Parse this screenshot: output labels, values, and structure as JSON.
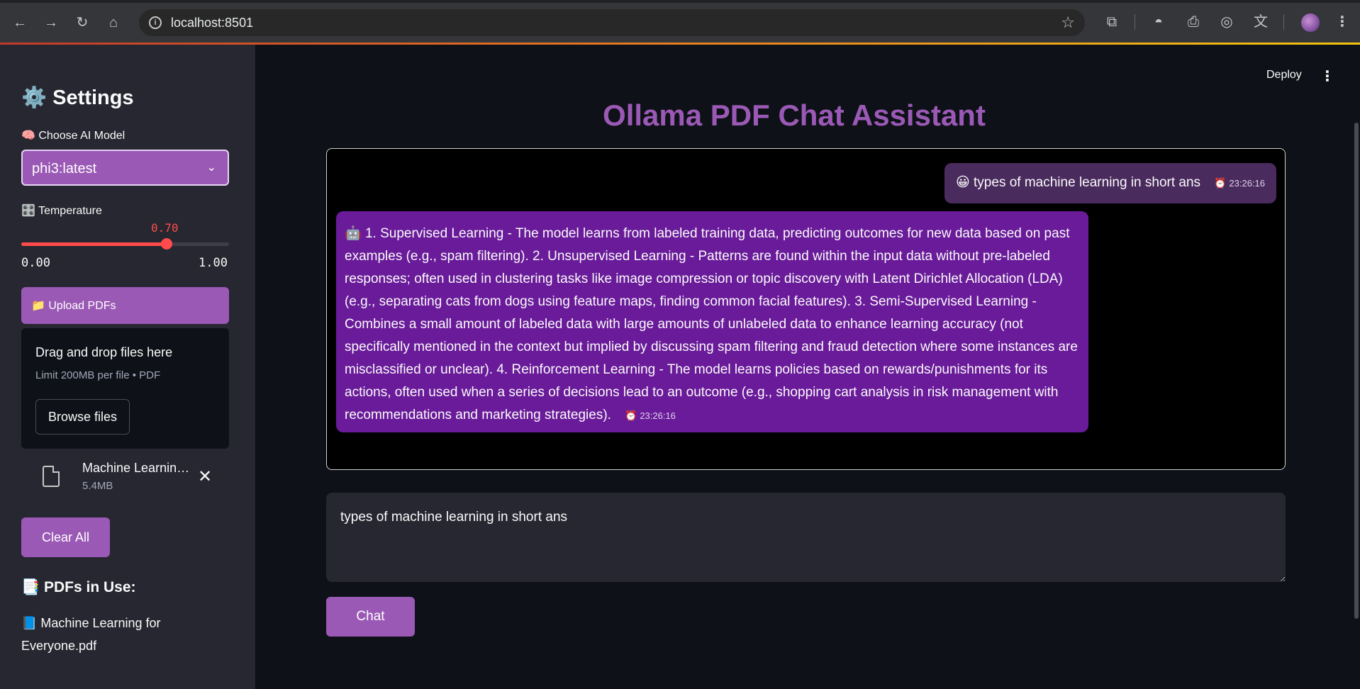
{
  "browser": {
    "url": "localhost:8501"
  },
  "sidebar": {
    "title": "⚙️ Settings",
    "model_label": "🧠 Choose AI Model",
    "model_value": "phi3:latest",
    "temperature_label": "🎛️ Temperature",
    "temperature_value": "0.70",
    "temperature_fraction": 0.7,
    "temperature_min": "0.00",
    "temperature_max": "1.00",
    "upload_label": "📁 Upload PDFs",
    "dropzone_title": "Drag and drop files here",
    "dropzone_limit": "Limit 200MB per file • PDF",
    "browse_label": "Browse files",
    "file_name": "Machine Learning for Everyone.pdf",
    "file_size": "5.4MB",
    "clear_label": "Clear All",
    "pdfs_title": "📑 PDFs in Use:",
    "pdf_items": [
      "📘 Machine Learning for Everyone.pdf"
    ]
  },
  "main": {
    "deploy_label": "Deploy",
    "title": "Ollama PDF Chat Assistant",
    "user_message": {
      "emoji": "😀",
      "text": "types of machine learning in short ans",
      "time": "23:26:16"
    },
    "bot_message": {
      "emoji": "🤖",
      "text": "1. Supervised Learning - The model learns from labeled training data, predicting outcomes for new data based on past examples (e.g., spam filtering). 2. Unsupervised Learning - Patterns are found within the input data without pre-labeled responses; often used in clustering tasks like image compression or topic discovery with Latent Dirichlet Allocation (LDA) (e.g., separating cats from dogs using feature maps, finding common facial features). 3. Semi-Supervised Learning - Combines a small amount of labeled data with large amounts of unlabeled data to enhance learning accuracy (not specifically mentioned in the context but implied by discussing spam filtering and fraud detection where some instances are misclassified or unclear). 4. Reinforcement Learning - The model learns policies based on rewards/punishments for its actions, often used when a series of decisions lead to an outcome (e.g., shopping cart analysis in risk management with recommendations and marketing strategies).",
      "time": "23:26:16"
    },
    "input_value": "types of machine learning in short ans",
    "chat_label": "Chat"
  },
  "colors": {
    "accent": "#9b59b6",
    "bot_bubble": "#6a1b9a",
    "user_bubble": "#4a2b5e",
    "slider": "#ff4b4b"
  }
}
